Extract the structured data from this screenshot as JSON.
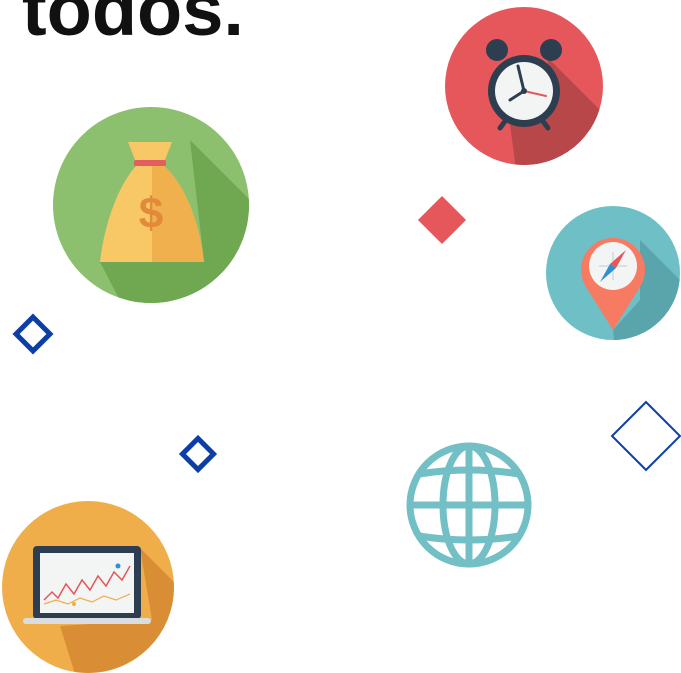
{
  "heading": {
    "text": "todos."
  },
  "icons": [
    {
      "name": "money-bag-icon",
      "color": "#8DC06E"
    },
    {
      "name": "alarm-clock-icon",
      "color": "#E5575A"
    },
    {
      "name": "map-pin-compass-icon",
      "color": "#6EC0C6"
    },
    {
      "name": "globe-icon",
      "color": "#72BFC6"
    },
    {
      "name": "laptop-chart-icon",
      "color": "#F0AE4A"
    }
  ],
  "decorations": [
    {
      "name": "filled-diamond-red",
      "color": "#E5575A"
    },
    {
      "name": "outline-diamond-blue",
      "color": "#0C3EA6"
    }
  ]
}
